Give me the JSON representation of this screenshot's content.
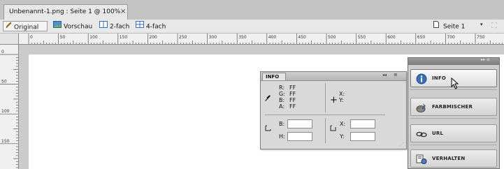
{
  "document": {
    "tab_title": "Unbenannt-1.png : Seite 1 @ 100%",
    "close_glyph": "×"
  },
  "view_toolbar": {
    "original": "Original",
    "vorschau": "Vorschau",
    "zweifach": "2-fach",
    "vierfach": "4-fach",
    "page_select": "Seite 1",
    "dropdown_glyph": "▾",
    "ghost_tool_glyph": "⛶"
  },
  "rulers": {
    "top_labels": [
      "0",
      "50",
      "100",
      "150",
      "200",
      "250",
      "300",
      "350",
      "400",
      "450",
      "500",
      "550",
      "600",
      "650",
      "700",
      "750",
      "80"
    ],
    "left_labels": [
      "0",
      "50",
      "100",
      "150"
    ]
  },
  "info_panel": {
    "tab_label": "INFO",
    "collapse_glyph": "◂◂",
    "menu_glyph": "≡",
    "rgb": [
      {
        "label": "R:",
        "value": "FF"
      },
      {
        "label": "G:",
        "value": "FF"
      },
      {
        "label": "B:",
        "value": "FF"
      },
      {
        "label": "A:",
        "value": "FF"
      }
    ],
    "coords": [
      {
        "label": "X:",
        "value": ""
      },
      {
        "label": "Y:",
        "value": ""
      }
    ],
    "size_fields": [
      {
        "label": "B:",
        "value": ""
      },
      {
        "label": "H:",
        "value": ""
      }
    ],
    "pos_fields": [
      {
        "label": "X:",
        "value": ""
      },
      {
        "label": "Y:",
        "value": ""
      }
    ],
    "grip_glyph": "⋰"
  },
  "dock": {
    "header_glyph": "▸▸ ≡",
    "items": [
      {
        "label": "INFO",
        "icon": "info-icon",
        "active": true
      },
      {
        "label": "FARBMISCHER",
        "icon": "color-mixer-icon",
        "active": false
      },
      {
        "label": "URL",
        "icon": "url-link-icon",
        "active": false
      },
      {
        "label": "VERHALTEN",
        "icon": "behaviors-icon",
        "active": false
      }
    ]
  },
  "colors": {
    "tab_bg": "#e8e8e8",
    "canvas": "#ffffff",
    "info_blue": "#3a6fb0",
    "panel_bg": "#d9d9d9"
  }
}
